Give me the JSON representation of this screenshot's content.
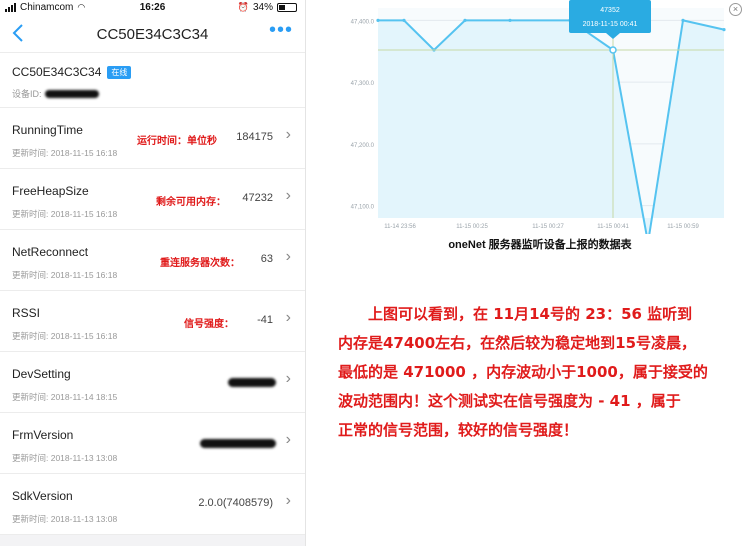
{
  "status_bar": {
    "carrier": "Chinamcom",
    "time": "16:26",
    "battery": "34%"
  },
  "nav": {
    "title": "CC50E34C3C34",
    "more": "•••"
  },
  "device": {
    "name": "CC50E34C3C34",
    "badge": "在线",
    "id_label": "设备ID:"
  },
  "rows": [
    {
      "name": "RunningTime",
      "updated": "更新时间: 2018-11-15 16:18",
      "note": "运行时间：单位秒",
      "value": "184175"
    },
    {
      "name": "FreeHeapSize",
      "updated": "更新时间: 2018-11-15 16:18",
      "note": "剩余可用内存：",
      "value": "47232"
    },
    {
      "name": "NetReconnect",
      "updated": "更新时间: 2018-11-15 16:18",
      "note": "重连服务器次数：",
      "value": "63"
    },
    {
      "name": "RSSI",
      "updated": "更新时间: 2018-11-15 16:18",
      "note": "信号强度：",
      "value": "-41"
    },
    {
      "name": "DevSetting",
      "updated": "更新时间: 2018-11-14 18:15",
      "note": "",
      "value": ""
    },
    {
      "name": "FrmVersion",
      "updated": "更新时间: 2018-11-13 13:08",
      "note": "",
      "value": ""
    },
    {
      "name": "SdkVersion",
      "updated": "更新时间: 2018-11-13 13:08",
      "note": "",
      "value": "2.0.0(7408579)"
    }
  ],
  "chart_data": {
    "type": "area",
    "x": [
      "11-14 23:56",
      "11-15 00:05",
      "11-15 00:10",
      "11-15 00:25",
      "11-15 00:27",
      "11-15 00:35",
      "11-15 00:41",
      "11-15 00:50",
      "11-15 00:59",
      "11-15 01:05"
    ],
    "series": [
      {
        "values": [
          47400,
          47400,
          47352,
          47400,
          47400,
          47400,
          47352,
          47040,
          47400,
          47385
        ]
      }
    ],
    "x_ticks": [
      "11-14 23:56",
      "11-15 00:25",
      "11-15 00:27",
      "11-15 00:41",
      "11-15 00:59"
    ],
    "y_ticks": [
      "47,400.0",
      "47,300.0",
      "47,200.0",
      "47,100.0"
    ],
    "ylim": [
      47080,
      47420
    ],
    "tooltip": {
      "value": "47352",
      "time": "2018-11-15 00:41"
    },
    "caption": "oneNet 服务器监听设备上报的数据表",
    "colors": {
      "line": "#55c3f0",
      "fill": "#e3f5fc",
      "tooltip": "#2aabe2"
    }
  },
  "explanation": [
    "上图可以看到，在 11月14号的 23：56 监听到",
    "内存是47400左右，在然后较为稳定地到15号凌晨，",
    "最低的是 471000 ，内存波动小于1000，属于接受的",
    "波动范围内！这个测试实在信号强度为 - 41 ，属于",
    "正常的信号范围，较好的信号强度！"
  ],
  "icons": {
    "back": "‹",
    "chevron": "›",
    "close": "×"
  }
}
